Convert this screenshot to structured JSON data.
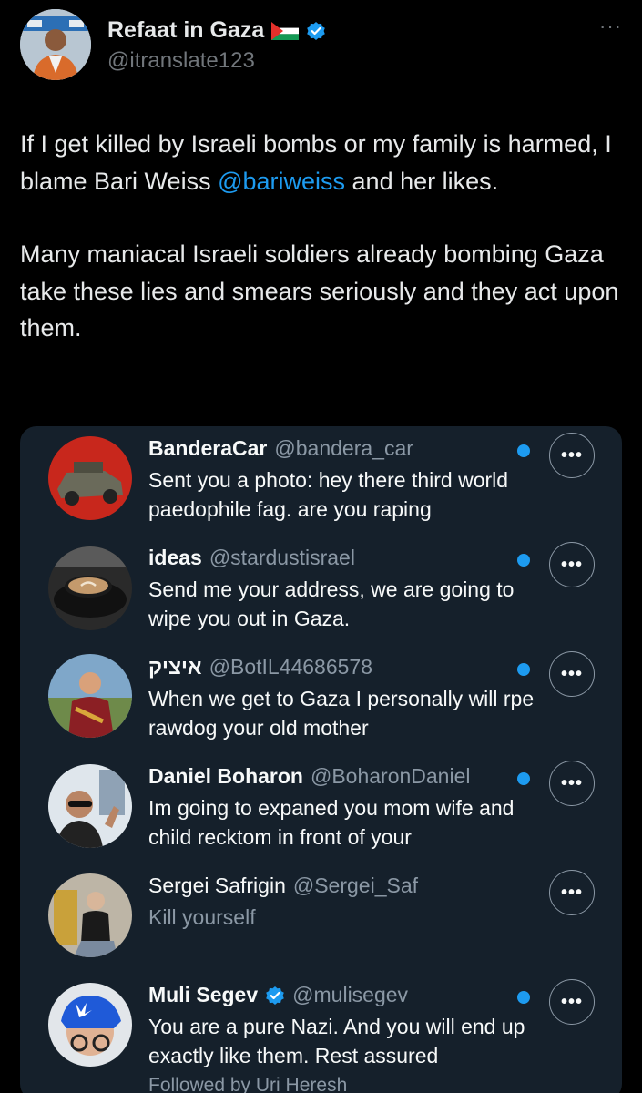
{
  "author": {
    "display_name": "Refaat in Gaza",
    "handle": "@itranslate123",
    "flag_icon": "palestine-flag-icon",
    "verified_icon": "verified-badge-icon",
    "more_icon": "ellipsis-icon"
  },
  "tweet": {
    "paragraph1_pre": "If I get killed by Israeli bombs or my family is harmed, I blame Bari Weiss ",
    "mention": "@bariweiss",
    "paragraph1_post": " and her likes.",
    "paragraph2": "Many maniacal Israeli soldiers already bombing Gaza take these lies and smears seriously and they act upon them."
  },
  "messages": [
    {
      "name": "BanderaCar",
      "handle": "@bandera_car",
      "text": "Sent you a photo: hey there third world paedophile fag. are you raping",
      "unread": true,
      "bold": true,
      "verified": false
    },
    {
      "name": "ideas",
      "handle": "@stardustisrael",
      "text": "Send me your address, we are going to wipe you out in Gaza.",
      "unread": true,
      "bold": true,
      "verified": false
    },
    {
      "name": "איציק",
      "handle": "@BotIL44686578",
      "text": "When we get to Gaza I personally will rpe rawdog your old mother",
      "unread": true,
      "bold": true,
      "verified": false
    },
    {
      "name": "Daniel Boharon",
      "handle": "@BoharonDaniel",
      "text": "Im going to expaned you mom wife and child recktom in front of your",
      "unread": true,
      "bold": true,
      "verified": false
    },
    {
      "name": "Sergei Safrigin",
      "handle": "@Sergei_Saf",
      "text": "Kill yourself",
      "unread": false,
      "bold": false,
      "verified": false
    },
    {
      "name": "Muli Segev",
      "handle": "@mulisegev",
      "text": "You are a pure Nazi. And you will end up exactly like them. Rest assured",
      "unread": true,
      "bold": true,
      "verified": true
    }
  ],
  "followed_by": "Followed by Uri Heresh",
  "more_button_label": "•••",
  "colors": {
    "accent": "#1d9bf0",
    "background": "#000000",
    "panel": "#15202b"
  }
}
